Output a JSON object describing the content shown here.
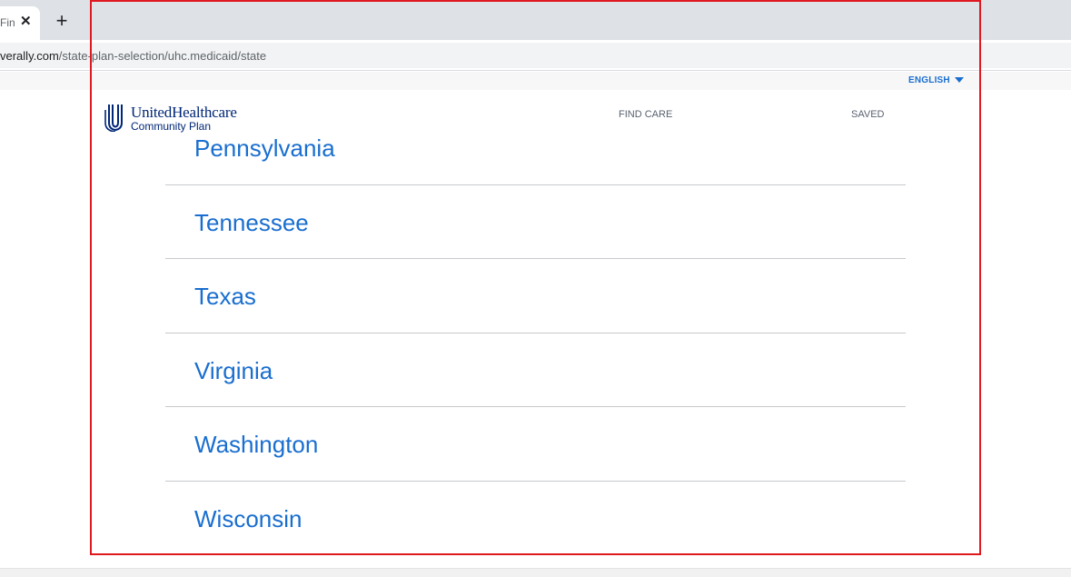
{
  "browser": {
    "tab": {
      "title": "Fin",
      "close_glyph": "✕"
    },
    "new_tab_glyph": "+",
    "url": {
      "host": "verally.com",
      "path": "/state-plan-selection/uhc.medicaid/state"
    }
  },
  "header": {
    "language": "ENGLISH",
    "logo": {
      "name": "UnitedHealthcare",
      "sub": "Community Plan"
    },
    "nav": {
      "find_care": "FIND CARE",
      "saved": "SAVED"
    }
  },
  "states": [
    {
      "name": "Pennsylvania"
    },
    {
      "name": "Tennessee"
    },
    {
      "name": "Texas"
    },
    {
      "name": "Virginia"
    },
    {
      "name": "Washington"
    },
    {
      "name": "Wisconsin"
    }
  ],
  "colors": {
    "brand_navy": "#002677",
    "link_blue": "#196ecf",
    "highlight_red": "#e0181f"
  }
}
